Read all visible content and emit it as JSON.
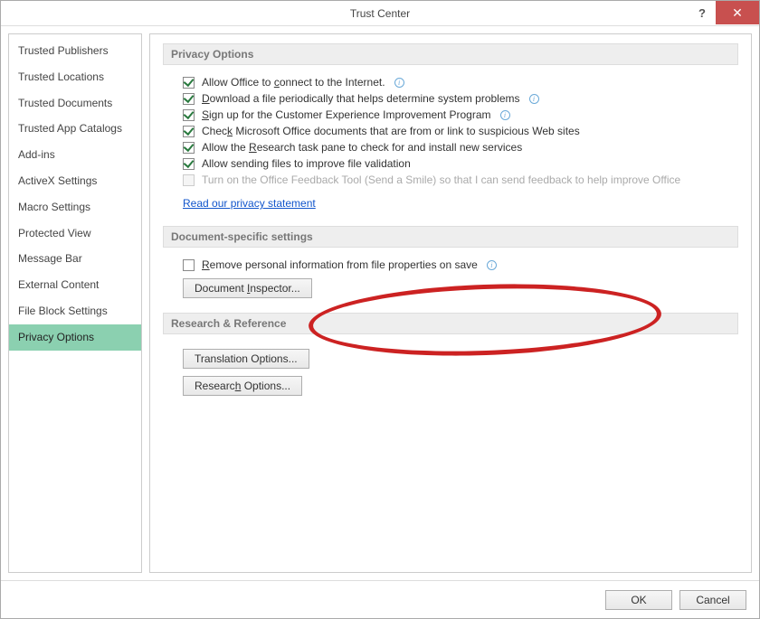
{
  "title": "Trust Center",
  "sidebar": {
    "items": [
      "Trusted Publishers",
      "Trusted Locations",
      "Trusted Documents",
      "Trusted App Catalogs",
      "Add-ins",
      "ActiveX Settings",
      "Macro Settings",
      "Protected View",
      "Message Bar",
      "External Content",
      "File Block Settings",
      "Privacy Options"
    ],
    "selected_index": 11
  },
  "sections": {
    "privacy": {
      "header": "Privacy Options",
      "options": [
        {
          "label_pre": "Allow Office to ",
          "u": "c",
          "label_post": "onnect to the Internet.",
          "checked": true,
          "info": true,
          "disabled": false
        },
        {
          "label_pre": "",
          "u": "D",
          "label_post": "ownload a file periodically that helps determine system problems",
          "checked": true,
          "info": true,
          "disabled": false
        },
        {
          "label_pre": "",
          "u": "S",
          "label_post": "ign up for the Customer Experience Improvement Program",
          "checked": true,
          "info": true,
          "disabled": false
        },
        {
          "label_pre": "Chec",
          "u": "k",
          "label_post": " Microsoft Office documents that are from or link to suspicious Web sites",
          "checked": true,
          "info": false,
          "disabled": false
        },
        {
          "label_pre": "Allow the ",
          "u": "R",
          "label_post": "esearch task pane to check for and install new services",
          "checked": true,
          "info": false,
          "disabled": false
        },
        {
          "label_pre": "Allow sending files to improve file validation",
          "u": "",
          "label_post": "",
          "checked": true,
          "info": false,
          "disabled": false
        },
        {
          "label_pre": "Turn on the Office Feedback Tool (Send a Smile) so that I can send feedback to help improve Office",
          "u": "",
          "label_post": "",
          "checked": false,
          "info": false,
          "disabled": true
        }
      ],
      "privacy_link": "Read our privacy statement"
    },
    "docspecific": {
      "header": "Document-specific settings",
      "option": {
        "label_pre": "",
        "u": "R",
        "label_post": "emove personal information from file properties on save",
        "checked": false,
        "info": true,
        "disabled": false
      },
      "inspector_btn_pre": "Document ",
      "inspector_btn_u": "I",
      "inspector_btn_post": "nspector..."
    },
    "research": {
      "header": "Research & Reference",
      "translation_btn": "Translation Options...",
      "research_btn_pre": "Researc",
      "research_btn_u": "h",
      "research_btn_post": " Options..."
    }
  },
  "footer": {
    "ok": "OK",
    "cancel": "Cancel"
  },
  "help_char": "?",
  "close_char": "✕",
  "info_char": "i"
}
